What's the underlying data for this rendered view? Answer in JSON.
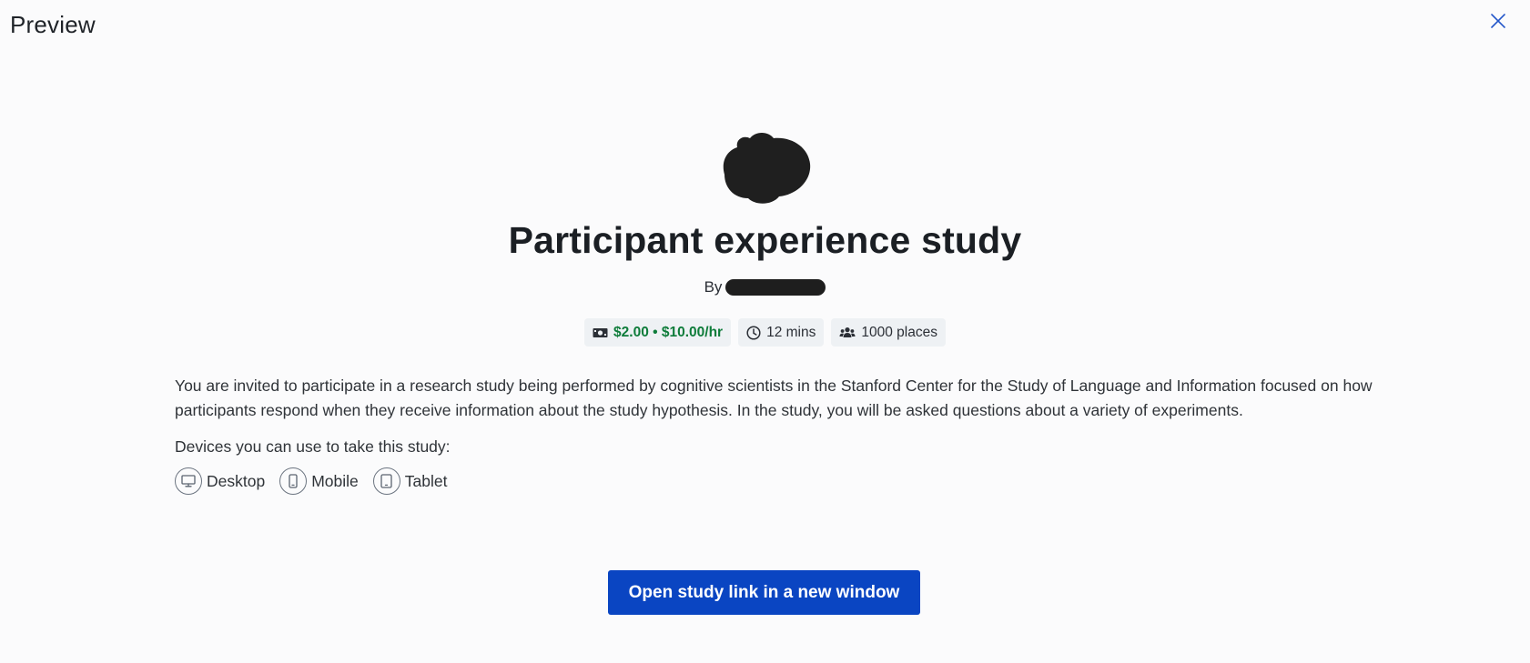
{
  "header": {
    "title": "Preview",
    "close_icon": "close-icon"
  },
  "study": {
    "title": "Participant experience study",
    "by_label": "By",
    "chips": {
      "reward": "$2.00 • $10.00/hr",
      "duration": "12 mins",
      "places": "1000 places"
    },
    "description": "You are invited to participate in a research study being performed by cognitive scientists in the Stanford Center for the Study of Language and Information focused on how participants respond when they receive information about the study hypothesis. In the study, you will be asked questions about a variety of experiments.",
    "devices_label": "Devices you can use to take this study:",
    "devices": [
      "Desktop",
      "Mobile",
      "Tablet"
    ]
  },
  "cta": {
    "label": "Open study link in a new window"
  },
  "colors": {
    "background": "#fbfbfc",
    "reward_green": "#0e7c3a",
    "primary_blue": "#0a45c2",
    "chip_bg": "#eef1f4"
  }
}
